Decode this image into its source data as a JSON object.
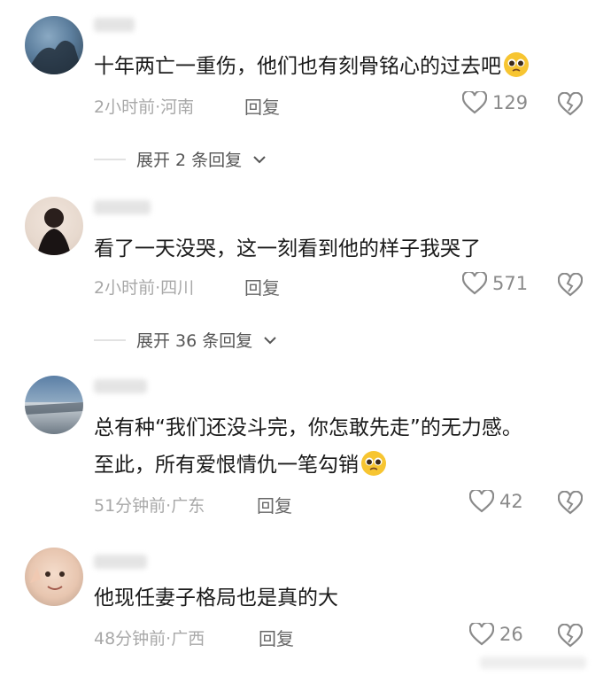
{
  "comments": [
    {
      "text_lines": [
        "十年两亡一重伤，他们也有刻骨铭心的过去吧"
      ],
      "has_emoji": true,
      "meta": "2小时前·河南",
      "reply_label": "回复",
      "likes": "129",
      "avatar_icon": "avatar-photo",
      "expand_label": "展开 2 条回复"
    },
    {
      "text_lines": [
        "看了一天没哭，这一刻看到他的样子我哭了"
      ],
      "has_emoji": false,
      "meta": "2小时前·四川",
      "reply_label": "回复",
      "likes": "571",
      "avatar_icon": "avatar-photo",
      "expand_label": "展开 36 条回复"
    },
    {
      "text_lines": [
        "总有种“我们还没斗完，你怎敢先走”的无力感。",
        "至此，所有爱恨情仇一笔勾销"
      ],
      "has_emoji": true,
      "meta": "51分钟前·广东",
      "reply_label": "回复",
      "likes": "42",
      "avatar_icon": "avatar-photo"
    },
    {
      "text_lines": [
        "他现任妻子格局也是真的大"
      ],
      "has_emoji": false,
      "meta": "48分钟前·广西",
      "reply_label": "回复",
      "likes": "26",
      "avatar_icon": "avatar-photo"
    }
  ],
  "icons": {
    "like": "heart-outline-icon",
    "dislike": "broken-heart-icon",
    "emoji": "pleading-face-emoji",
    "expand": "chevron-down-icon"
  },
  "colors": {
    "text": "#1a1a1a",
    "meta": "#a8a8a8",
    "reply": "#666666",
    "icon": "#8a8a8a",
    "emoji": "#f7c531"
  }
}
